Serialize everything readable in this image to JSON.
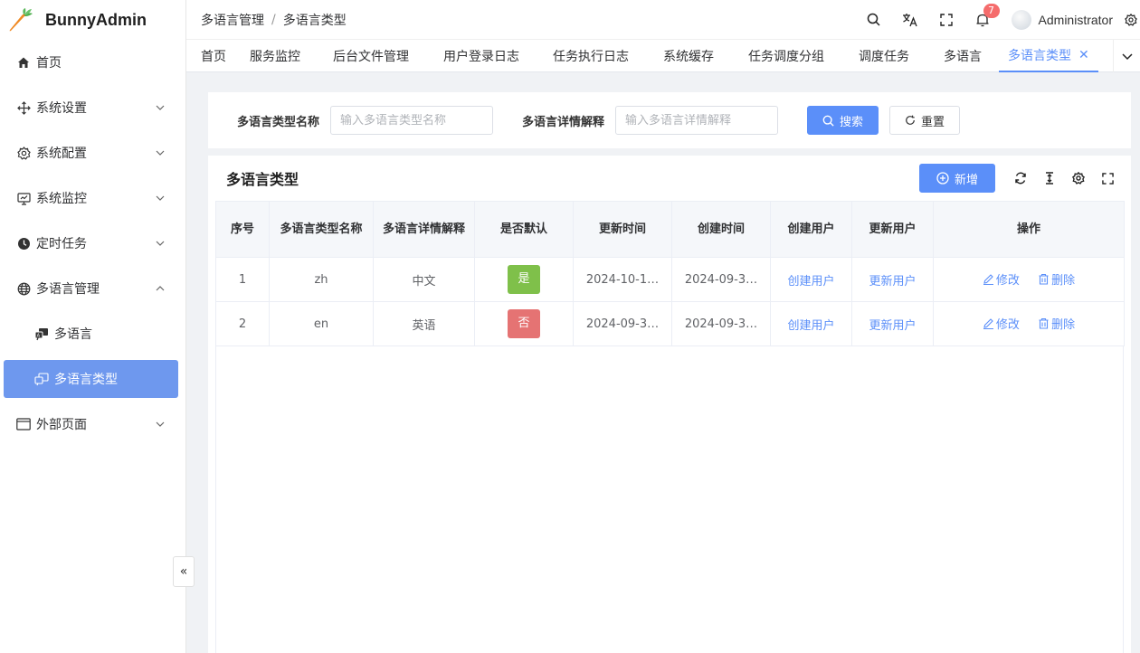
{
  "app": {
    "name": "BunnyAdmin"
  },
  "sidebar": {
    "items": [
      {
        "label": "首页"
      },
      {
        "label": "系统设置"
      },
      {
        "label": "系统配置"
      },
      {
        "label": "系统监控"
      },
      {
        "label": "定时任务"
      },
      {
        "label": "多语言管理"
      },
      {
        "label": "多语言"
      },
      {
        "label": "多语言类型"
      },
      {
        "label": "外部页面"
      }
    ],
    "collapse_label": "«"
  },
  "header": {
    "breadcrumb": [
      "多语言管理",
      "多语言类型"
    ],
    "separator": "/",
    "notification_count": "7",
    "user": "Administrator"
  },
  "tabs": [
    "首页",
    "服务监控",
    "后台文件管理",
    "用户登录日志",
    "任务执行日志",
    "系统缓存",
    "任务调度分组",
    "调度任务",
    "多语言",
    "多语言类型"
  ],
  "search": {
    "type_name_label": "多语言类型名称",
    "type_name_placeholder": "输入多语言类型名称",
    "summary_label": "多语言详情解释",
    "summary_placeholder": "输入多语言详情解释",
    "search_button": "搜索",
    "reset_button": "重置"
  },
  "table": {
    "title": "多语言类型",
    "add_button": "新增",
    "columns": [
      "序号",
      "多语言类型名称",
      "多语言详情解释",
      "是否默认",
      "更新时间",
      "创建时间",
      "创建用户",
      "更新用户",
      "操作"
    ],
    "rows": [
      {
        "index": "1",
        "type_name": "zh",
        "summary": "中文",
        "is_default": "是",
        "update_time": "2024-10-1…",
        "create_time": "2024-09-3…",
        "create_user": "创建用户",
        "update_user": "更新用户"
      },
      {
        "index": "2",
        "type_name": "en",
        "summary": "英语",
        "is_default": "否",
        "update_time": "2024-09-3…",
        "create_time": "2024-09-3…",
        "create_user": "创建用户",
        "update_user": "更新用户"
      }
    ],
    "edit_label": "修改",
    "delete_label": "删除"
  },
  "colors": {
    "primary": "#5b8ff9",
    "sidebar_active": "#6e98ee",
    "tag_yes": "#7fc04a",
    "tag_no": "#e57373"
  }
}
